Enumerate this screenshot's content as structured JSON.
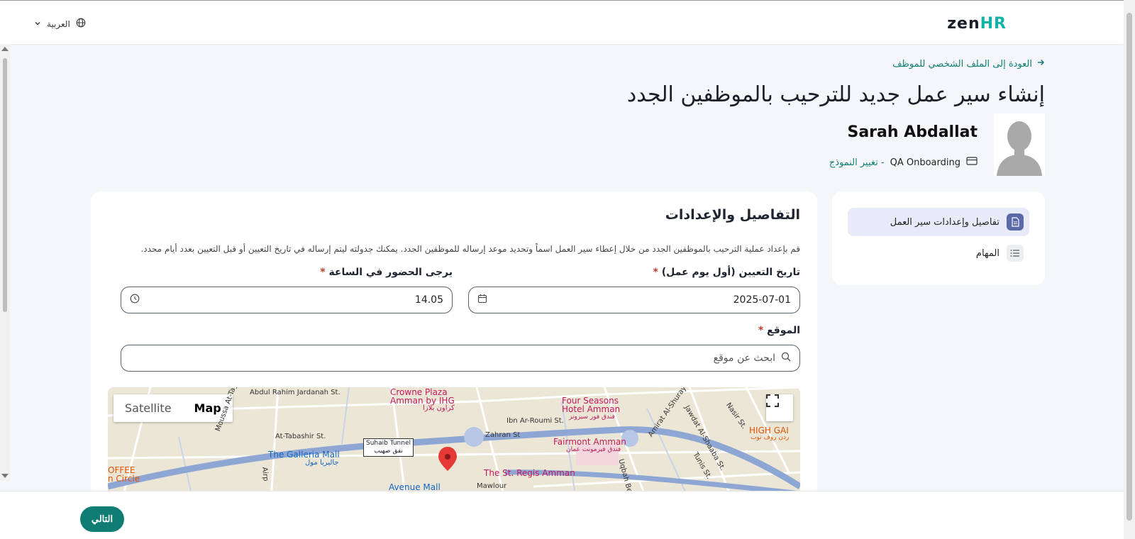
{
  "header": {
    "logo_zen": "zen",
    "logo_hr": "HR",
    "language": "العربية",
    "accent_color": "#0f7d73"
  },
  "page": {
    "back_link": "العودة إلى الملف الشخصي للموظف",
    "title": "إنشاء سير عمل جديد للترحيب بالموظفين الجدد"
  },
  "employee": {
    "name": "Sarah Abdallat",
    "template_name": "QA Onboarding",
    "change_template": "- تغيير النموذج"
  },
  "sidenav": {
    "items": [
      {
        "label": "تفاصيل وإعدادات سير العمل",
        "icon": "document-icon",
        "active": true
      },
      {
        "label": "المهام",
        "icon": "list-icon",
        "active": false
      }
    ]
  },
  "section": {
    "title": "التفاصيل والإعدادات",
    "description": "قم بإعداد عملية الترحيب بالموظفين الجدد من خلال إعطاء سير العمل اسماً وتحديد موعد إرساله للموظفين الجدد. يمكنك جدولته ليتم إرساله في تاريخ التعيين أو قبل التعيين بعدد أيام محدد."
  },
  "form": {
    "hire_date_label": "تاريخ التعيين (أول يوم عمل)",
    "hire_date_value": "2025-07-01",
    "arrival_time_label": "يرجى الحضور في الساعة",
    "arrival_time_value": "14.05",
    "location_label": "الموقع",
    "location_placeholder": "ابحث عن موقع",
    "required_mark": "*"
  },
  "map": {
    "satellite_label": "Satellite",
    "map_label": "Map",
    "places": {
      "crowne": "Crowne Plaza",
      "crowne2": "Amman by IHG",
      "crowne_ar": "كراون بلازا",
      "four_seasons": "Four Seasons",
      "four_seasons2": "Hotel Amman",
      "four_seasons_ar": "فندق فور سيزونز",
      "fairmont": "Fairmont Amman",
      "fairmont_ar": "فندق فيرمونت عمان",
      "stregis": "The St. Regis Amman",
      "galleria": "The Galleria Mall",
      "galleria_ar": "جاليريا مول",
      "avenue": "Avenue Mall",
      "high": "HIGH GAI",
      "high_ar": "ردن روف توب",
      "offee": "OFFEE",
      "circle": "n Circle",
      "tunnel": "Suhaib Tunnel",
      "tunnel_ar": "نفق صهيب",
      "street1": "Abdul Rahim Jardanah St.",
      "street2": "At-Tabashir St.",
      "street3": "Zahran St",
      "street4": "Ibn Ar-Roumi St.",
      "street5": "Mawlour",
      "street6": "Moussa At-Tayeb",
      "street7": "Nasir St.",
      "street8": "Jawdat Al-Shaaba St.",
      "street9": "Tunis St.",
      "street10": "Amirat Al-Shuraya St.",
      "street11": "Uqbah Ben",
      "street12": "Airp"
    }
  },
  "footer": {
    "next_label": "التالي"
  }
}
